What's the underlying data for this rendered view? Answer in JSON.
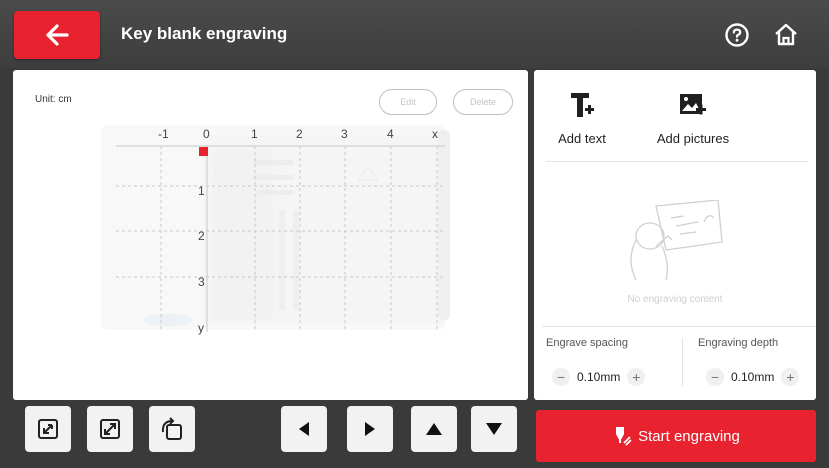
{
  "header": {
    "title": "Key blank engraving",
    "back_icon": "arrow-left-icon",
    "help_icon": "question-circle-icon",
    "home_icon": "home-icon",
    "accent": "#e8232f"
  },
  "canvas": {
    "unit_label": "Unit: cm",
    "edit_label": "Edit",
    "delete_label": "Delete",
    "x_ticks": [
      "-1",
      "0",
      "1",
      "2",
      "3",
      "4",
      "x"
    ],
    "y_ticks": [
      "1",
      "2",
      "3",
      "y"
    ]
  },
  "tools": {
    "add_text_label": "Add text",
    "add_pictures_label": "Add pictures",
    "empty_text": "No engraving content"
  },
  "settings": {
    "spacing_label": "Engrave spacing",
    "spacing_value": "0.10mm",
    "depth_label": "Engraving depth",
    "depth_value": "0.10mm",
    "minus": "−",
    "plus": "+"
  },
  "toolbar": {
    "icons": [
      "shrink-icon",
      "expand-icon",
      "rotate-icon",
      "left-arrow-icon",
      "right-arrow-icon",
      "up-arrow-icon",
      "down-arrow-icon"
    ]
  },
  "start": {
    "label": "Start engraving"
  }
}
